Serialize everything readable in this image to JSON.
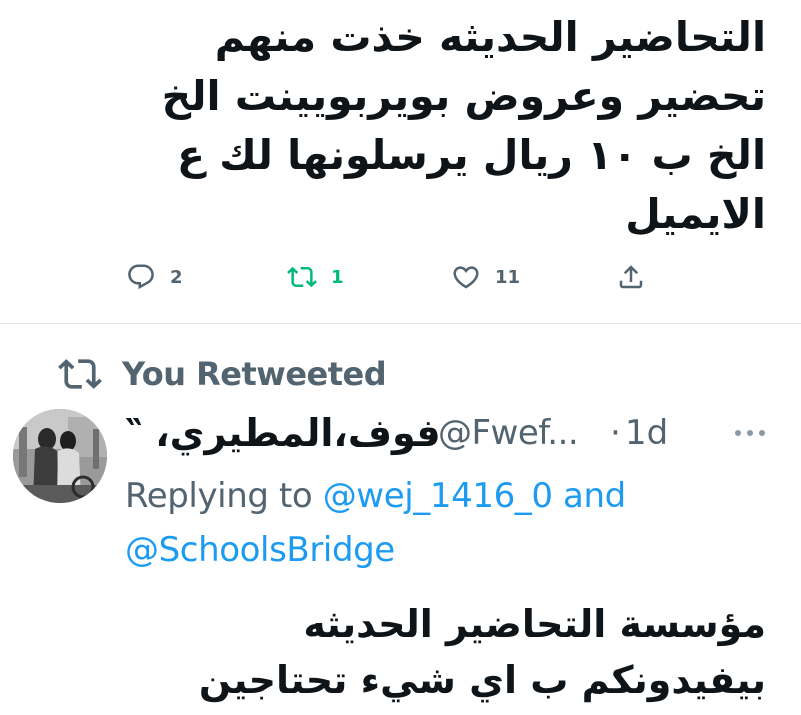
{
  "tweet1": {
    "text": "التحاضير الحديثه خذت منهم\nتحضير وعروض بويربويينت الخ\nالخ ب ١٠ ريال يرسلونها لك ع\nالايميل",
    "actions": {
      "reply_count": "2",
      "retweet_count": "1",
      "like_count": "11"
    }
  },
  "retweet_context": {
    "label": "You Retweeted"
  },
  "tweet2": {
    "display_name": "فوف،المطيري، ‶",
    "handle": "@Fwef...",
    "dot": "·",
    "time": "1d",
    "replying_prefix": "Replying to ",
    "mention1": "@wej_1416_0",
    "and_word": " and",
    "mention2": "@SchoolsBridge",
    "text": "مؤسسة التحاضير الحديثه\nبيفيدونكم ب اي شيء تحتاجين"
  },
  "colors": {
    "text_primary": "#0f1419",
    "text_secondary": "#536471",
    "link": "#1d9bf0",
    "retweet_green": "#00ba7c",
    "divider": "#e6e9eb"
  },
  "icons": {
    "reply": "reply-bubble-icon",
    "retweet": "retweet-arrows-icon",
    "like": "heart-outline-icon",
    "share": "share-upload-icon",
    "more": "more-dots-icon"
  }
}
